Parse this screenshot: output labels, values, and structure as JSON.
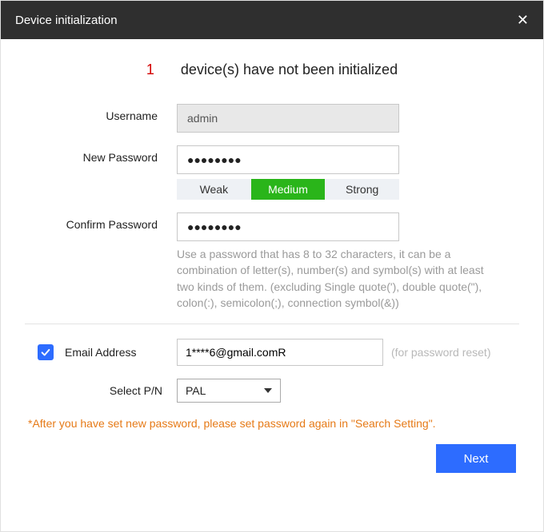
{
  "header": {
    "title": "Device initialization"
  },
  "banner": {
    "count": "1",
    "text": "device(s) have not been initialized"
  },
  "username": {
    "label": "Username",
    "value": "admin"
  },
  "newPassword": {
    "label": "New Password",
    "value": "●●●●●●●●"
  },
  "strength": {
    "weak": "Weak",
    "medium": "Medium",
    "strong": "Strong",
    "active": "medium"
  },
  "confirmPassword": {
    "label": "Confirm Password",
    "value": "●●●●●●●●"
  },
  "passwordHint": "Use a password that has 8 to 32 characters, it can be a combination of letter(s), number(s) and symbol(s) with at least two kinds of them. (excluding Single quote('), double quote(\"), colon(:), semicolon(;), connection symbol(&))",
  "email": {
    "label": "Email Address",
    "value": "1****6@gmail.comR",
    "hint": "(for password reset)",
    "checked": true
  },
  "pn": {
    "label": "Select P/N",
    "value": "PAL"
  },
  "warning": "*After you have set new password, please set password again in \"Search Setting\".",
  "footer": {
    "next": "Next"
  }
}
